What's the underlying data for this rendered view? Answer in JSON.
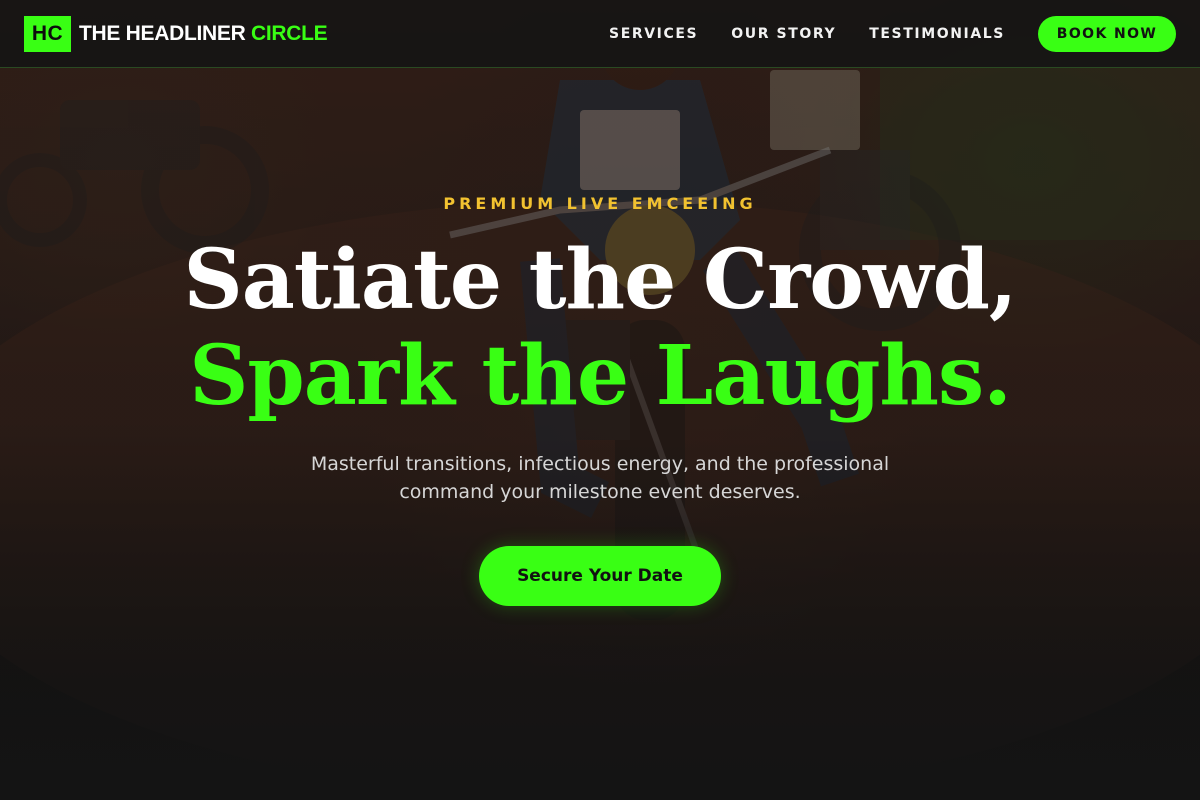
{
  "brand": {
    "badge": "HC",
    "name_main": "THE HEADLINER ",
    "name_accent": "CIRCLE"
  },
  "nav": {
    "items": [
      {
        "label": "SERVICES"
      },
      {
        "label": "OUR STORY"
      },
      {
        "label": "TESTIMONIALS"
      }
    ],
    "cta_label": "BOOK NOW"
  },
  "hero": {
    "eyebrow": "PREMIUM LIVE EMCEEING",
    "headline_line1": "Satiate the Crowd,",
    "headline_line2": "Spark the Laughs.",
    "subtitle": "Masterful transitions, infectious energy, and the professional command your milestone event deserves.",
    "cta_label": "Secure Your Date"
  },
  "colors": {
    "accent": "#39ff14",
    "eyebrow": "#f2c230",
    "background": "#121212",
    "text": "#ffffff"
  },
  "background_image": {
    "subject": "motorcycle rider on dirt track",
    "icon": "hero-photo"
  }
}
